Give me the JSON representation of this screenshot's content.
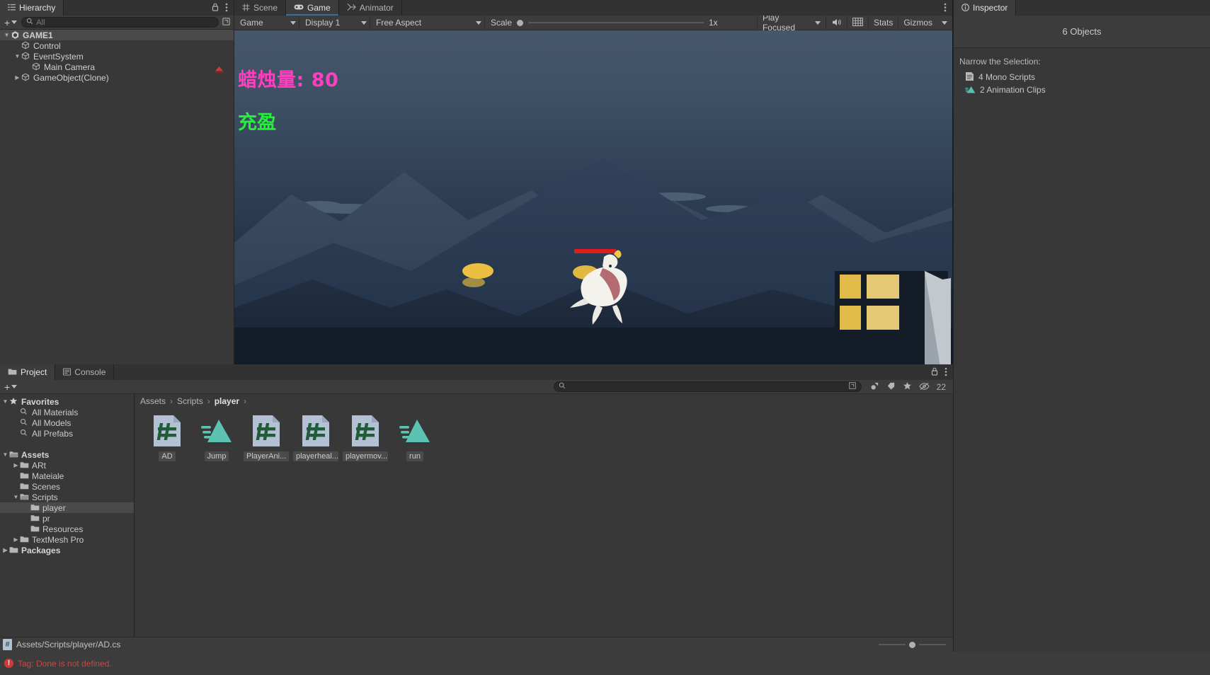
{
  "hierarchy": {
    "tab_label": "Hierarchy",
    "lock_icon": "lock-icon",
    "menu_icon": "kebab-menu-icon",
    "add_label": "+",
    "search_placeholder": "All",
    "search_icon": "search-icon",
    "filter_icon": "filter-icon",
    "items": [
      {
        "label": "GAME1",
        "depth": 0,
        "icon": "unity-scene-icon",
        "expanded": true,
        "selected": true
      },
      {
        "label": "Control",
        "depth": 1,
        "icon": "gameobject-cube-icon",
        "expanded": null,
        "selected": false
      },
      {
        "label": "EventSystem",
        "depth": 1,
        "icon": "gameobject-cube-icon",
        "expanded": true,
        "selected": false
      },
      {
        "label": "Main Camera",
        "depth": 2,
        "icon": "gameobject-cube-icon",
        "expanded": null,
        "selected": false
      },
      {
        "label": "GameObject(Clone)",
        "depth": 1,
        "icon": "gameobject-cube-icon",
        "expanded": false,
        "selected": false
      }
    ]
  },
  "gameview": {
    "tabs": [
      {
        "label": "Scene",
        "icon": "scene-grid-icon",
        "active": false
      },
      {
        "label": "Game",
        "icon": "gamepad-icon",
        "active": true
      },
      {
        "label": "Animator",
        "icon": "animator-icon",
        "active": false
      }
    ],
    "menu_icon": "kebab-menu-icon",
    "toolbar": {
      "target_display_label": "Game",
      "display_label": "Display 1",
      "aspect_label": "Free Aspect",
      "scale_label": "Scale",
      "scale_value": "1x",
      "play_mode_label": "Play Focused",
      "mute_icon": "speaker-icon",
      "stats_icon": "stats-grid-icon",
      "stats_label": "Stats",
      "gizmos_label": "Gizmos"
    },
    "hud": {
      "candle_text": "蜡烛量: 80",
      "candle_color": "#ff3fbf",
      "state_text": "充盈",
      "state_color": "#25ef3a"
    }
  },
  "inspector": {
    "tab_label": "Inspector",
    "info_icon": "info-icon",
    "object_count_label": "6 Objects",
    "narrow_label": "Narrow the Selection:",
    "items": [
      {
        "label": "4 Mono Scripts",
        "icon": "script-document-icon"
      },
      {
        "label": "2 Animation Clips",
        "icon": "animation-clip-icon"
      }
    ]
  },
  "project": {
    "tabs": [
      {
        "label": "Project",
        "icon": "folder-icon",
        "active": true
      },
      {
        "label": "Console",
        "icon": "console-icon",
        "active": false
      }
    ],
    "lock_icon": "lock-icon",
    "menu_icon": "kebab-menu-icon",
    "add_label": "+",
    "search_placeholder": "",
    "search_icon": "search-icon",
    "toolbar_icons": [
      {
        "name": "search-by-type-icon"
      },
      {
        "name": "label-tag-icon"
      },
      {
        "name": "favorite-star-icon"
      },
      {
        "name": "hidden-packages-icon"
      }
    ],
    "hidden_count": "22",
    "tree": [
      {
        "label": "Favorites",
        "depth": 0,
        "icon": "star-icon",
        "expanded": true,
        "bold": true,
        "selected": false
      },
      {
        "label": "All Materials",
        "depth": 1,
        "icon": "search-icon",
        "expanded": null,
        "bold": false,
        "selected": false
      },
      {
        "label": "All Models",
        "depth": 1,
        "icon": "search-icon",
        "expanded": null,
        "bold": false,
        "selected": false
      },
      {
        "label": "All Prefabs",
        "depth": 1,
        "icon": "search-icon",
        "expanded": null,
        "bold": false,
        "selected": false
      },
      {
        "label": "",
        "depth": 0,
        "icon": "spacer",
        "expanded": null,
        "bold": false,
        "selected": false
      },
      {
        "label": "Assets",
        "depth": 0,
        "icon": "folder-open-icon",
        "expanded": true,
        "bold": true,
        "selected": false
      },
      {
        "label": "ARt",
        "depth": 1,
        "icon": "folder-icon",
        "expanded": false,
        "bold": false,
        "selected": false
      },
      {
        "label": "Mateiale",
        "depth": 1,
        "icon": "folder-icon",
        "expanded": null,
        "bold": false,
        "selected": false
      },
      {
        "label": "Scenes",
        "depth": 1,
        "icon": "folder-icon",
        "expanded": null,
        "bold": false,
        "selected": false
      },
      {
        "label": "Scripts",
        "depth": 1,
        "icon": "folder-open-icon",
        "expanded": true,
        "bold": false,
        "selected": false
      },
      {
        "label": "player",
        "depth": 2,
        "icon": "folder-icon",
        "expanded": null,
        "bold": false,
        "selected": true
      },
      {
        "label": "pr",
        "depth": 2,
        "icon": "folder-icon",
        "expanded": null,
        "bold": false,
        "selected": false
      },
      {
        "label": "Resources",
        "depth": 2,
        "icon": "folder-icon",
        "expanded": null,
        "bold": false,
        "selected": false
      },
      {
        "label": "TextMesh Pro",
        "depth": 1,
        "icon": "folder-icon",
        "expanded": false,
        "bold": false,
        "selected": false
      },
      {
        "label": "Packages",
        "depth": 0,
        "icon": "folder-icon",
        "expanded": false,
        "bold": true,
        "selected": false
      }
    ],
    "breadcrumb": [
      "Assets",
      "Scripts",
      "player"
    ],
    "assets": [
      {
        "label": "AD",
        "type": "csharp-script"
      },
      {
        "label": "Jump",
        "type": "animation-clip"
      },
      {
        "label": "PlayerAni...",
        "type": "csharp-script"
      },
      {
        "label": "playerheal...",
        "type": "csharp-script"
      },
      {
        "label": "playermov...",
        "type": "csharp-script"
      },
      {
        "label": "run",
        "type": "animation-clip"
      }
    ],
    "status_path": "Assets/Scripts/player/AD.cs",
    "status_icon": "csharp-script-icon"
  },
  "statusbar": {
    "error_icon": "error-icon",
    "error_text": "Tag: Done is not defined."
  }
}
